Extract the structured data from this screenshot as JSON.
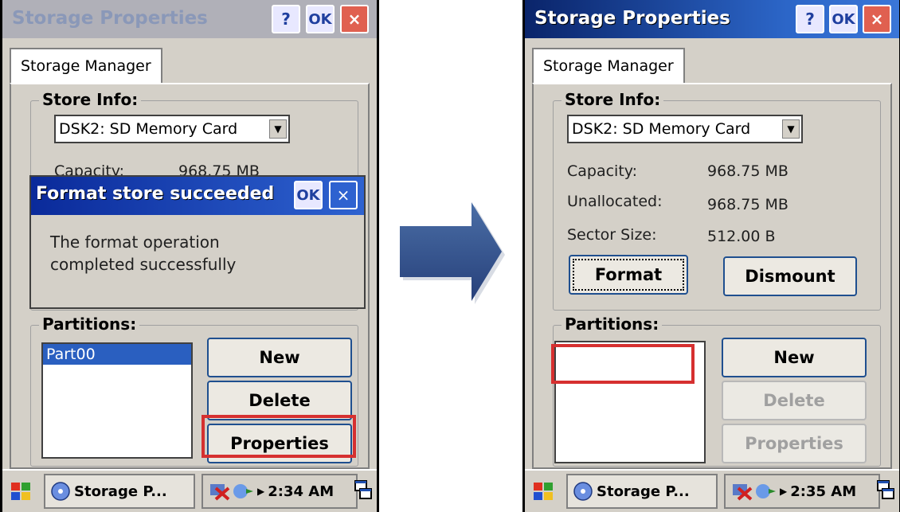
{
  "before": {
    "window_title": "Storage Properties",
    "tab_label": "Storage Manager",
    "store_info_label": "Store Info:",
    "store_selected": "DSK2: SD Memory Card",
    "capacity_label": "Capacity:",
    "capacity_value": "968.75 MB",
    "partitions_label": "Partitions:",
    "partitions": [
      "Part00"
    ],
    "buttons": {
      "new": "New",
      "delete": "Delete",
      "properties": "Properties"
    },
    "dialog": {
      "title": "Format store succeeded",
      "ok": "OK",
      "message_line1": "The format operation",
      "message_line2": "completed successfully"
    },
    "taskbar": {
      "task": "Storage P...",
      "time": "2:34 AM"
    }
  },
  "after": {
    "window_title": "Storage Properties",
    "tab_label": "Storage Manager",
    "store_info_label": "Store Info:",
    "store_selected": "DSK2: SD Memory Card",
    "capacity_label": "Capacity:",
    "capacity_value": "968.75 MB",
    "unallocated_label": "Unallocated:",
    "unallocated_value": "968.75 MB",
    "sector_label": "Sector Size:",
    "sector_value": "512.00 B",
    "format_button": "Format",
    "dismount_button": "Dismount",
    "partitions_label": "Partitions:",
    "partitions": [],
    "buttons": {
      "new": "New",
      "delete": "Delete",
      "properties": "Properties"
    },
    "taskbar": {
      "task": "Storage P...",
      "time": "2:35 AM"
    }
  },
  "titlebar_buttons": {
    "help": "?",
    "ok": "OK",
    "close": "×"
  },
  "colors": {
    "highlight": "#d63030",
    "active_title": "#0a246a",
    "selection": "#2a5fc0"
  }
}
